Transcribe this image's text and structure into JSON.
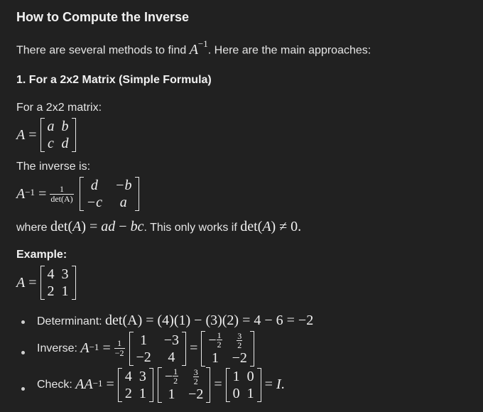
{
  "heading": "How to Compute the Inverse",
  "intro_text": "There are several methods to find",
  "intro_tail": ". Here are the main approaches:",
  "section1_title": "1. For a 2x2 Matrix (Simple Formula)",
  "for_2x2_text": "For a 2x2 matrix:",
  "matrix_A_general": [
    "a",
    "b",
    "c",
    "d"
  ],
  "inverse_is_text": "The inverse is:",
  "adjugate_entries": [
    "d",
    "−b",
    "−c",
    "a"
  ],
  "det_label": "det(A)",
  "frac_one": "1",
  "where_text": "where",
  "condition_text": ". This only works if",
  "example_title": "Example:",
  "matrix_A_example": [
    "4",
    "3",
    "2",
    "1"
  ],
  "determinant_label": "Determinant:",
  "determinant_expr": "det(A) = (4)(1) − (3)(2) = 4 − 6 = −2",
  "inverse_label": "Inverse:",
  "inverse_frac_den": "−2",
  "inverse_mid_matrix": [
    "1",
    "−3",
    "−2",
    "4"
  ],
  "inverse_result_matrix_right": {
    "num": "3",
    "den": "2"
  },
  "check_label": "Check:",
  "identity": [
    "1",
    "0",
    "0",
    "1"
  ],
  "half": {
    "num": "1",
    "den": "2"
  }
}
